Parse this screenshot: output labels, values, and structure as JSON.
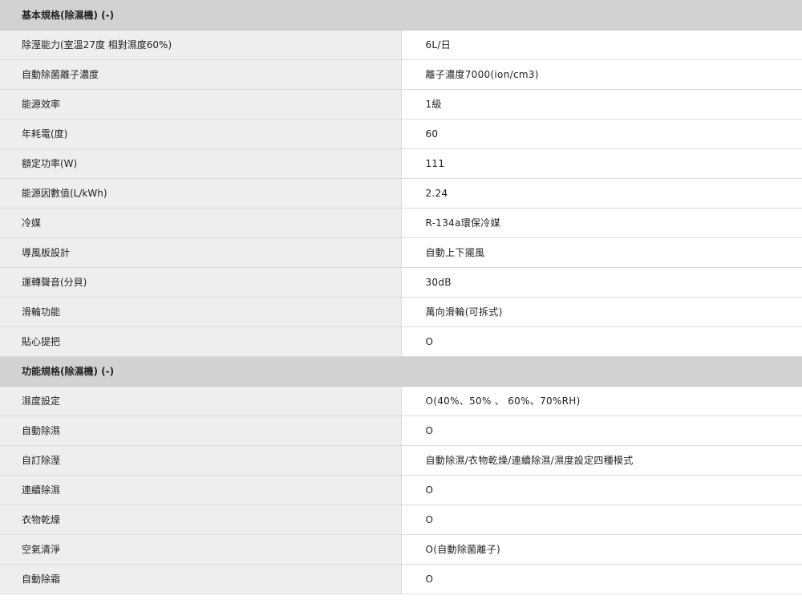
{
  "sections": [
    {
      "title": "基本規格(除濕機) (-)",
      "rows": [
        {
          "label": "除溼能力(室溫27度 相對濕度60%)",
          "value": "6L/日"
        },
        {
          "label": "自動除菌離子濃度",
          "value": "離子濃度7000(ion/cm3)"
        },
        {
          "label": "能源效率",
          "value": "1級"
        },
        {
          "label": "年耗電(度)",
          "value": "60"
        },
        {
          "label": "額定功率(W)",
          "value": "111"
        },
        {
          "label": "能源因數值(L/kWh)",
          "value": "2.24"
        },
        {
          "label": "冷媒",
          "value": "R-134a環保冷媒"
        },
        {
          "label": "導風板設計",
          "value": "自動上下擺風"
        },
        {
          "label": "運轉聲音(分貝)",
          "value": "30dB"
        },
        {
          "label": "滑輪功能",
          "value": "萬向滑輪(可拆式)"
        },
        {
          "label": "貼心提把",
          "value": "O"
        }
      ]
    },
    {
      "title": "功能規格(除濕機) (-)",
      "rows": [
        {
          "label": "濕度設定",
          "value": "O(40%、50% 、 60%、70%RH)"
        },
        {
          "label": "自動除濕",
          "value": "O"
        },
        {
          "label": "自訂除溼",
          "value": "自動除濕/衣物乾燥/連續除濕/濕度設定四種模式"
        },
        {
          "label": "連續除濕",
          "value": "O"
        },
        {
          "label": "衣物乾燥",
          "value": "O"
        },
        {
          "label": "空氣清淨",
          "value": "O(自動除菌離子)"
        },
        {
          "label": "自動除霜",
          "value": "O"
        }
      ]
    }
  ]
}
